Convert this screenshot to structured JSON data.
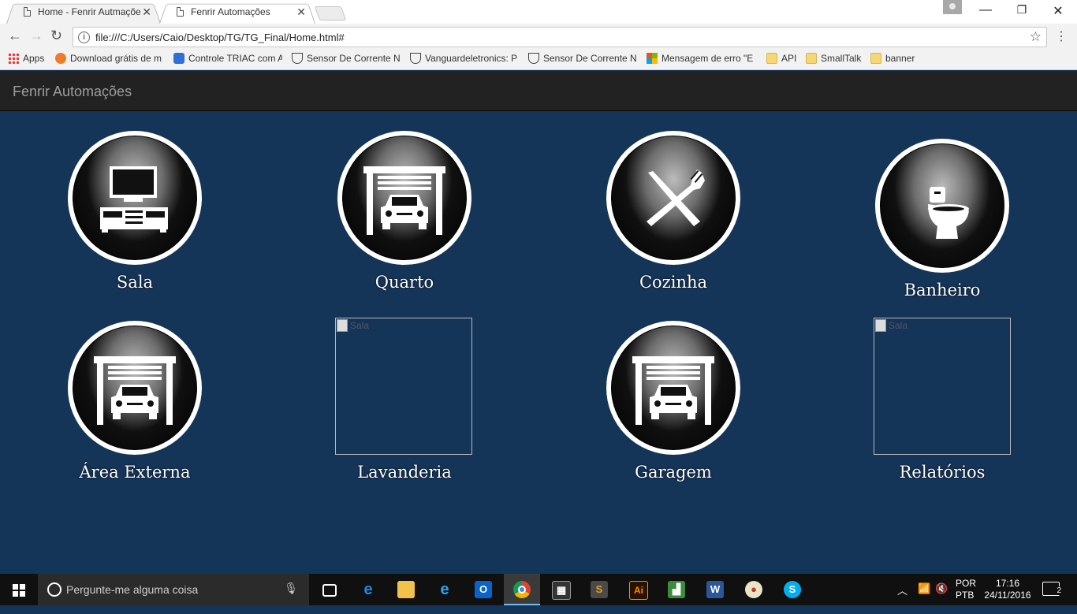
{
  "browser": {
    "tabs": [
      {
        "title": "Home - Fenrir Autmaçõe",
        "close": "✕"
      },
      {
        "title": "Fenrir Automações",
        "close": "✕"
      }
    ],
    "window_controls": {
      "minimize": "—",
      "restore": "❐",
      "close": "✕"
    },
    "address": "file:///C:/Users/Caio/Desktop/TG/TG_Final/Home.html#",
    "bookmarks": [
      {
        "label": "Apps",
        "icon": "apps-icon"
      },
      {
        "label": "Download grátis de m",
        "icon": "flower-icon"
      },
      {
        "label": "Controle TRIAC com A",
        "icon": "people-icon"
      },
      {
        "label": "Sensor De Corrente N",
        "icon": "bowl-icon"
      },
      {
        "label": "Vanguardeletronics: P",
        "icon": "bowl-icon"
      },
      {
        "label": "Sensor De Corrente N",
        "icon": "bowl-icon"
      },
      {
        "label": "Mensagem de erro \"E",
        "icon": "microsoft-icon"
      },
      {
        "label": "API",
        "icon": "folder-icon"
      },
      {
        "label": "SmallTalk",
        "icon": "folder-icon"
      },
      {
        "label": "banner",
        "icon": "folder-icon"
      }
    ]
  },
  "navbar": {
    "brand": "Fenrir Automações"
  },
  "rooms": [
    {
      "label": "Sala",
      "icon": "tv-stand-icon"
    },
    {
      "label": "Quarto",
      "icon": "garage-car-icon"
    },
    {
      "label": "Cozinha",
      "icon": "fork-knife-icon"
    },
    {
      "label": "Banheiro",
      "icon": "toilet-icon"
    },
    {
      "label": "Área Externa",
      "icon": "garage-car-icon"
    },
    {
      "label": "Lavanderia",
      "icon": "broken-image",
      "alt": "Sala"
    },
    {
      "label": "Garagem",
      "icon": "garage-car-icon"
    },
    {
      "label": "Relatórios",
      "icon": "broken-image",
      "alt": "Sala"
    }
  ],
  "taskbar": {
    "search_placeholder": "Pergunte-me alguma coisa",
    "language_1": "POR",
    "language_2": "PTB",
    "time": "17:16",
    "date": "24/11/2016",
    "notifications": "2"
  }
}
